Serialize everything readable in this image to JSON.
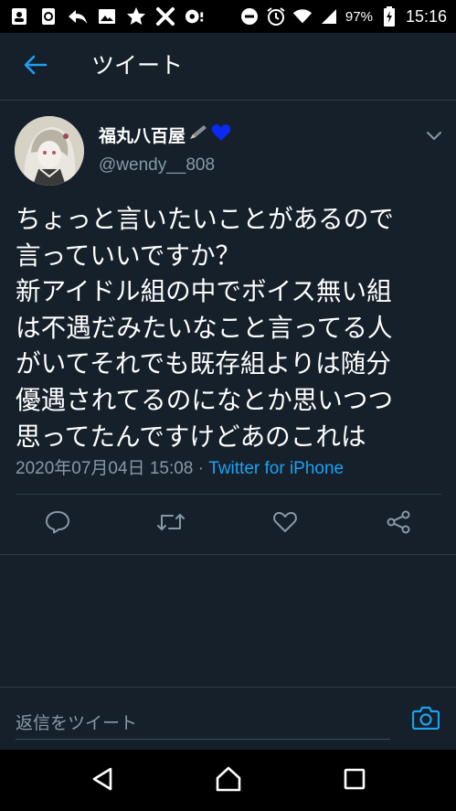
{
  "status_bar": {
    "battery_percent": "97%",
    "time": "15:16",
    "left_icons": [
      "contacts-icon",
      "sync-icon",
      "reply-arrow-icon",
      "image-icon",
      "star-icon",
      "tools-icon",
      "toggle-icon"
    ],
    "right_icons": [
      "do-not-disturb-icon",
      "alarm-icon",
      "wifi-icon",
      "signal-icon",
      "battery-charging-icon"
    ]
  },
  "header": {
    "title": "ツイート",
    "back_icon": "back-arrow-icon"
  },
  "tweet": {
    "author_name": "福丸八百屋",
    "author_emoji": [
      "pencil-icon",
      "blue-heart-icon"
    ],
    "handle": "@wendy__808",
    "text_lines": [
      "ちょっと言いたいことがあるので",
      "言っていいですか？",
      "新アイドル組の中でボイス無い組",
      "は不遇だみたいなこと言ってる人",
      "がいてそれでも既存組よりは随分",
      "優遇されてるのになとか思いつつ",
      "思ってたんですけどあのこれは"
    ],
    "timestamp": "2020年07月04日 15:08",
    "separator": "·",
    "source": "Twitter for iPhone"
  },
  "actions": {
    "reply": "reply-icon",
    "retweet": "retweet-icon",
    "like": "heart-icon",
    "share": "share-icon"
  },
  "reply_bar": {
    "placeholder": "返信をツイート"
  },
  "colors": {
    "background": "#15202b",
    "accent": "#1da1f2",
    "secondary_text": "#8899a6",
    "divider": "#2f3b47"
  }
}
